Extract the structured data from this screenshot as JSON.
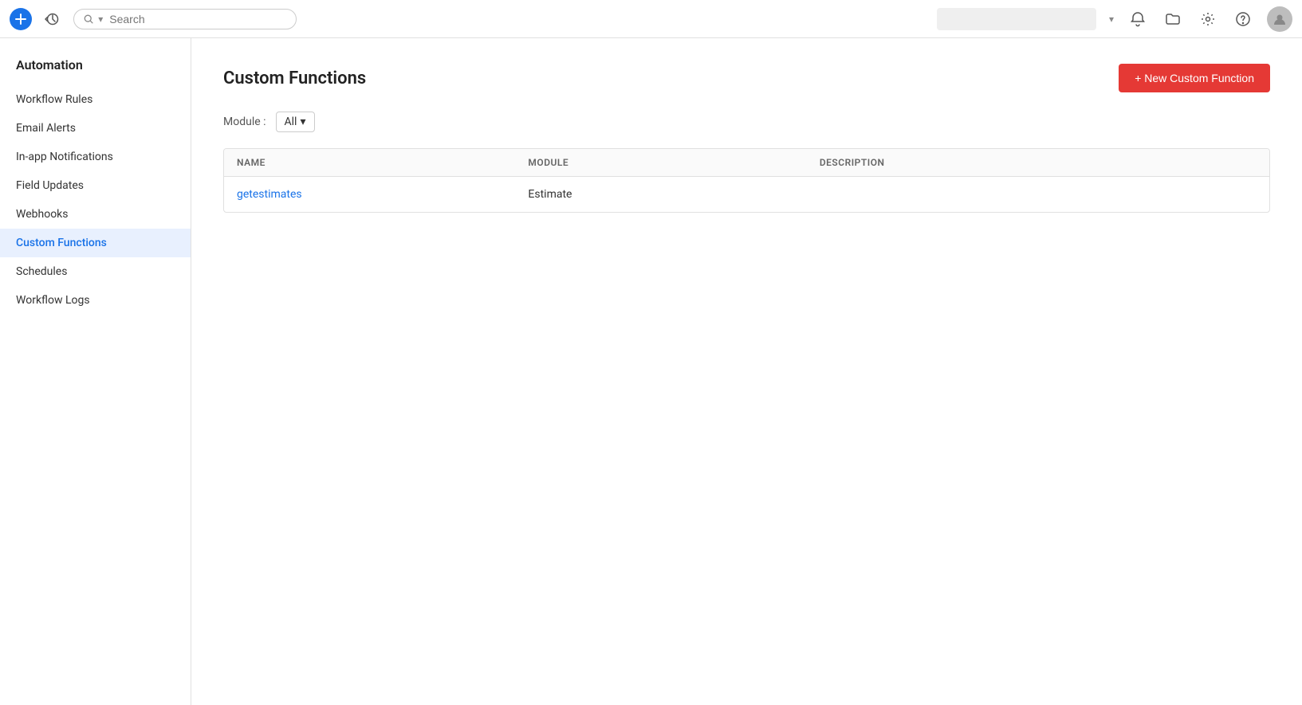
{
  "topbar": {
    "search_placeholder": "Search",
    "add_icon": "+",
    "new_function_label": "+ New Custom Function"
  },
  "sidebar": {
    "title": "Automation",
    "items": [
      {
        "id": "workflow-rules",
        "label": "Workflow Rules",
        "active": false
      },
      {
        "id": "email-alerts",
        "label": "Email Alerts",
        "active": false
      },
      {
        "id": "inapp-notifications",
        "label": "In-app Notifications",
        "active": false
      },
      {
        "id": "field-updates",
        "label": "Field Updates",
        "active": false
      },
      {
        "id": "webhooks",
        "label": "Webhooks",
        "active": false
      },
      {
        "id": "custom-functions",
        "label": "Custom Functions",
        "active": true
      },
      {
        "id": "schedules",
        "label": "Schedules",
        "active": false
      },
      {
        "id": "workflow-logs",
        "label": "Workflow Logs",
        "active": false
      }
    ]
  },
  "main": {
    "title": "Custom Functions",
    "new_button_label": "+ New Custom Function",
    "module_label": "Module :",
    "module_selected": "All",
    "table": {
      "headers": [
        "NAME",
        "MODULE",
        "DESCRIPTION"
      ],
      "rows": [
        {
          "name": "getestimates",
          "module": "Estimate",
          "description": ""
        }
      ]
    }
  }
}
